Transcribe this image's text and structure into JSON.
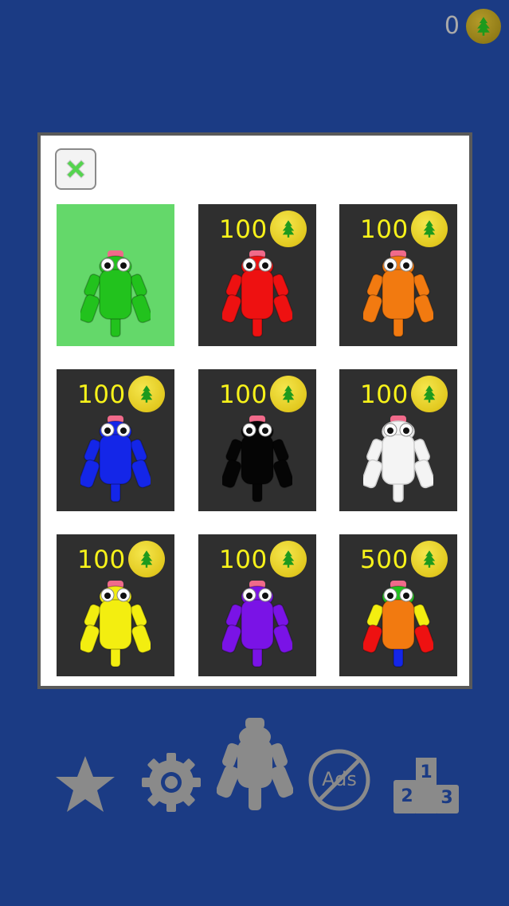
{
  "header": {
    "coin_count": "0",
    "coin_icon": "tree-coin-icon"
  },
  "shop": {
    "close_icon": "close-x-icon",
    "items": [
      {
        "color": "green",
        "price": "",
        "selected": true,
        "body": "#22c21d",
        "eye_bg": "#22c21d"
      },
      {
        "color": "red",
        "price": "100",
        "selected": false,
        "body": "#ee1111"
      },
      {
        "color": "orange",
        "price": "100",
        "selected": false,
        "body": "#f27a10"
      },
      {
        "color": "blue",
        "price": "100",
        "selected": false,
        "body": "#1426e8"
      },
      {
        "color": "black",
        "price": "100",
        "selected": false,
        "body": "#050505"
      },
      {
        "color": "white",
        "price": "100",
        "selected": false,
        "body": "#f4f4f4"
      },
      {
        "color": "yellow",
        "price": "100",
        "selected": false,
        "body": "#f3ee10"
      },
      {
        "color": "purple",
        "price": "100",
        "selected": false,
        "body": "#7a13e6"
      },
      {
        "color": "rainbow",
        "price": "500",
        "selected": false,
        "body": "#f27a10"
      }
    ]
  },
  "nav": {
    "ads_label": "Ads",
    "podium_first": "1",
    "podium_second": "2",
    "podium_third": "3"
  },
  "colors": {
    "background": "#1b3b84",
    "tile_dark": "#2f2f2f",
    "tile_selected": "#64d86a",
    "price_text": "#f7f21a",
    "nav_icon": "#8a8a8a"
  }
}
